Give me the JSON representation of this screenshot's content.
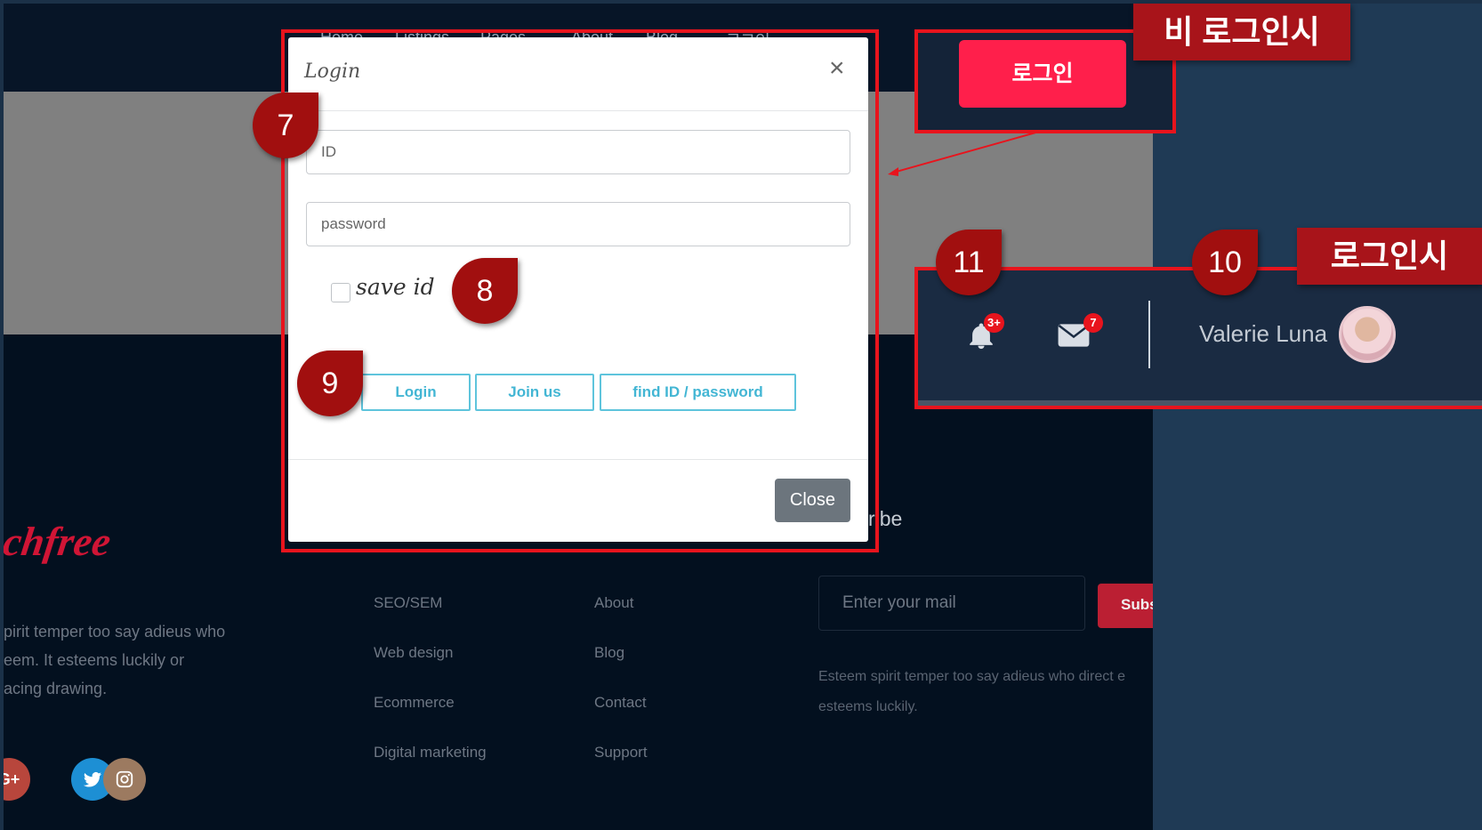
{
  "site": {
    "nav_items": [
      "Home",
      "Listings",
      "Pages",
      "About",
      "Blog",
      "로그인"
    ],
    "brand_partial": "chfree",
    "blurb_lines": [
      "pirit temper too say adieus who",
      "eem. It esteems luckily or",
      "acing drawing."
    ],
    "links_col1": [
      "SEO/SEM",
      "Web design",
      "Ecommerce",
      "Digital marketing"
    ],
    "links_col2": [
      "About",
      "Blog",
      "Contact",
      "Support"
    ],
    "subscribe_title": "ribe",
    "mail_placeholder": "Enter your mail",
    "subscribe_button": "Subs",
    "subscribe_text": "Esteem spirit temper too say adieus who direct e esteems luckily.",
    "social": [
      "G+",
      "twitter-icon",
      "instagram-icon"
    ]
  },
  "modal": {
    "title": "Login",
    "close_x": "×",
    "id_placeholder": "ID",
    "password_placeholder": "password",
    "save_id_label": "save id",
    "login_button": "Login",
    "join_button": "Join us",
    "find_button": "find ID / password",
    "close_button": "Close"
  },
  "markers": {
    "m7": "7",
    "m8": "8",
    "m9": "9",
    "m10": "10",
    "m11": "11"
  },
  "callouts": {
    "logged_out_label": "비 로그인시",
    "login_button_ko": "로그인",
    "logged_in_label": "로그인시",
    "notification_count": "3+",
    "message_count": "7",
    "user_name": "Valerie Luna"
  },
  "colors": {
    "accent_red": "#e8141d",
    "marker_red": "#a10f0f",
    "cta_pink": "#ff1f4b",
    "button_cyan": "#43b6d4"
  }
}
